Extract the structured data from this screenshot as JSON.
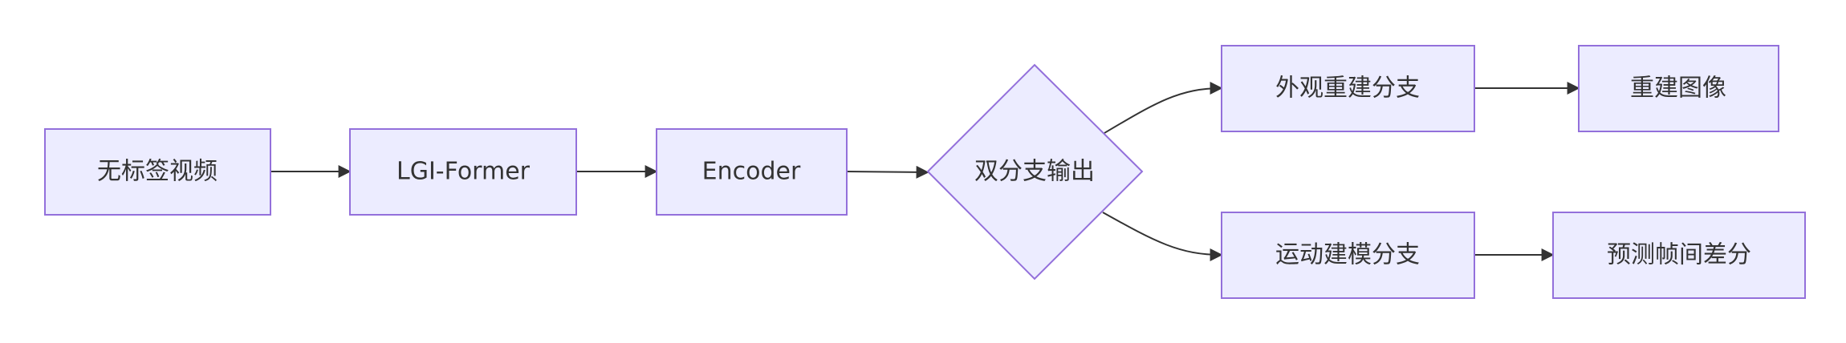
{
  "diagram": {
    "type": "flowchart",
    "direction": "left-to-right",
    "colors": {
      "node_fill": "#ececff",
      "node_border": "#9370db",
      "edge": "#333333",
      "text": "#333333",
      "background": "#ffffff"
    },
    "nodes": {
      "input": {
        "label": "无标签视频",
        "shape": "rectangle"
      },
      "lgi": {
        "label": "LGI-Former",
        "shape": "rectangle"
      },
      "encoder": {
        "label": "Encoder",
        "shape": "rectangle"
      },
      "decision": {
        "label": "双分支输出",
        "shape": "diamond"
      },
      "appearance": {
        "label": "外观重建分支",
        "shape": "rectangle"
      },
      "recon": {
        "label": "重建图像",
        "shape": "rectangle"
      },
      "motion": {
        "label": "运动建模分支",
        "shape": "rectangle"
      },
      "diff": {
        "label": "预测帧间差分",
        "shape": "rectangle"
      }
    },
    "edges": [
      {
        "from": "input",
        "to": "lgi"
      },
      {
        "from": "lgi",
        "to": "encoder"
      },
      {
        "from": "encoder",
        "to": "decision"
      },
      {
        "from": "decision",
        "to": "appearance"
      },
      {
        "from": "decision",
        "to": "motion"
      },
      {
        "from": "appearance",
        "to": "recon"
      },
      {
        "from": "motion",
        "to": "diff"
      }
    ]
  }
}
